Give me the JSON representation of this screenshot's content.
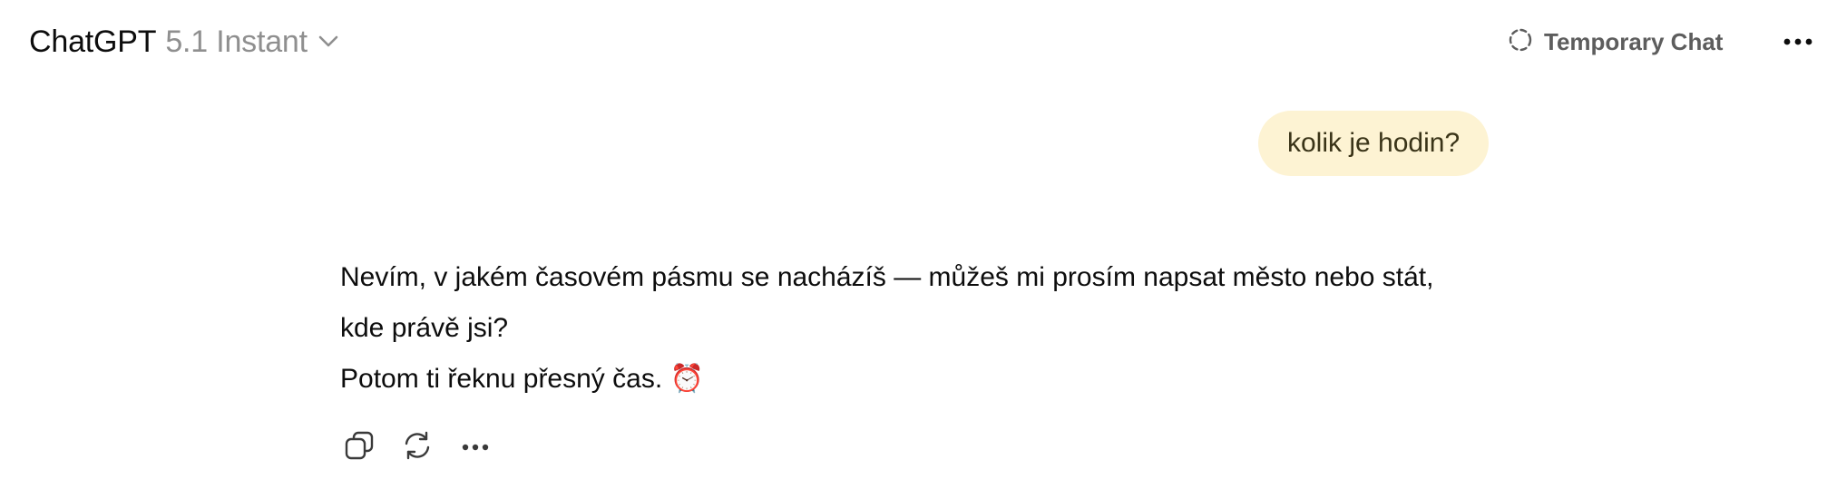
{
  "header": {
    "app_name": "ChatGPT",
    "model": "5.1 Instant",
    "model_dropdown_icon": "chevron-down-icon",
    "temporary_chat": {
      "icon": "dashed-circle-icon",
      "label": "Temporary Chat"
    },
    "more_icon": "ellipsis-horizontal-icon"
  },
  "conversation": {
    "user_message": "kolik je hodin?",
    "assistant_message": {
      "paragraph_1": "Nevím, v jakém časovém pásmu se nacházíš — můžeš mi prosím napsat město nebo stát, kde právě jsi?",
      "paragraph_2": "Potom ti řeknu přesný čas. ⏰"
    },
    "actions": [
      {
        "name": "copy",
        "icon": "copy-icon"
      },
      {
        "name": "regenerate",
        "icon": "refresh-icon"
      },
      {
        "name": "more",
        "icon": "ellipsis-horizontal-icon"
      }
    ]
  },
  "colors": {
    "user_bubble_bg": "#fdf3d3",
    "model_name_gray": "#8f8f8f",
    "temporary_chat_gray": "#5d5d5d",
    "text": "#0d0d0d"
  }
}
